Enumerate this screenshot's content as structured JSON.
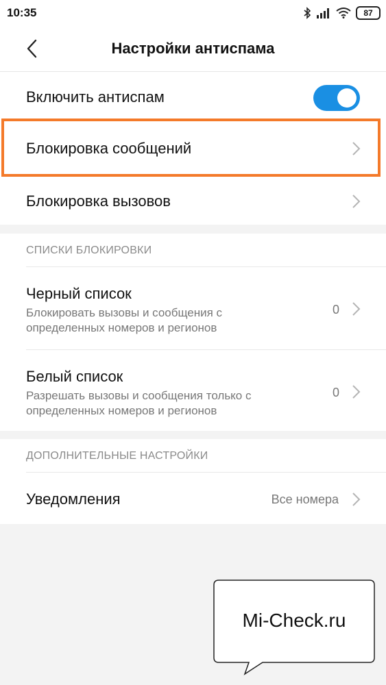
{
  "status": {
    "time": "10:35",
    "battery": "87",
    "icons": [
      "bluetooth-icon",
      "signal-icon",
      "wifi-icon",
      "battery-icon"
    ]
  },
  "header": {
    "title": "Настройки антиспама",
    "back_icon": "back-arrow-icon"
  },
  "main": {
    "enable_label": "Включить антиспам",
    "enable_on": true,
    "message_block_label": "Блокировка сообщений",
    "call_block_label": "Блокировка вызовов"
  },
  "block_lists": {
    "header": "СПИСКИ БЛОКИРОВКИ",
    "items": [
      {
        "title": "Черный список",
        "subtitle": "Блокировать вызовы и сообщения с определенных номеров и регионов",
        "count": "0"
      },
      {
        "title": "Белый список",
        "subtitle": "Разрешать вызовы и сообщения только с определенных номеров и регионов",
        "count": "0"
      }
    ]
  },
  "extra": {
    "header": "ДОПОЛНИТЕЛЬНЫЕ НАСТРОЙКИ",
    "notifications_label": "Уведомления",
    "notifications_value": "Все номера"
  },
  "watermark": "Mi-Check.ru",
  "colors": {
    "accent": "#1a8fe3",
    "highlight": "#f47a2a",
    "background": "#f3f3f3"
  }
}
